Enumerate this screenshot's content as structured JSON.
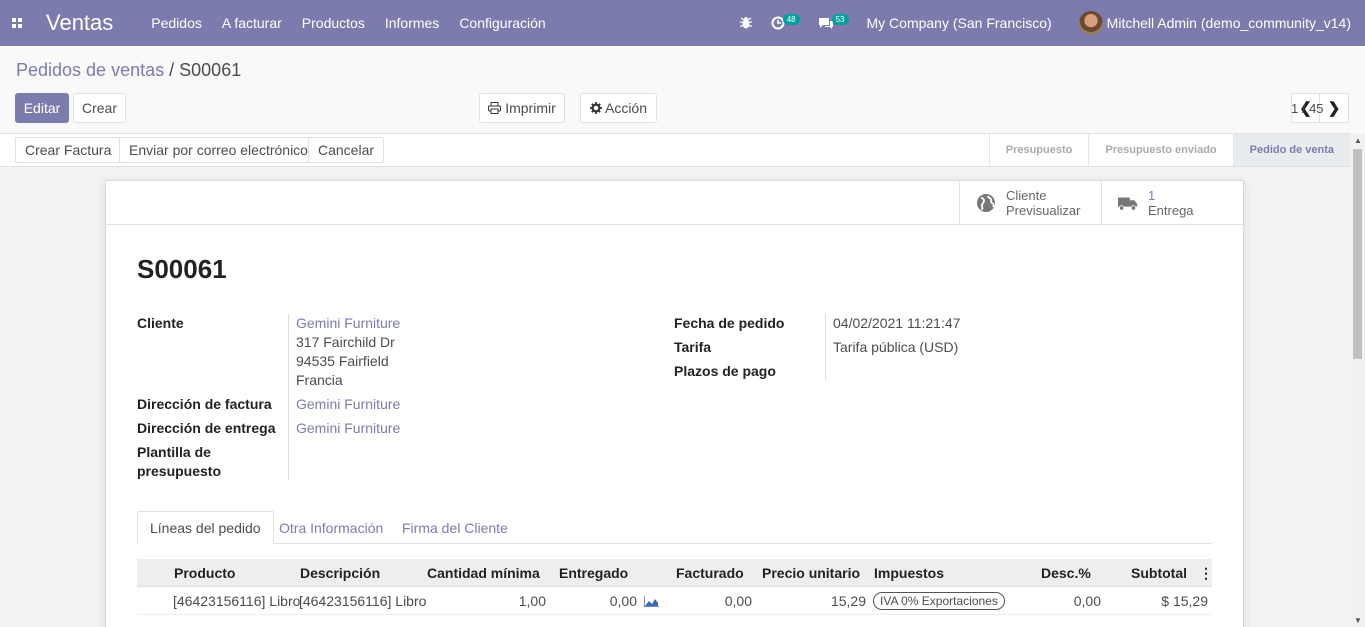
{
  "navbar": {
    "app_name": "Ventas",
    "menu": [
      "Pedidos",
      "A facturar",
      "Productos",
      "Informes",
      "Configuración"
    ],
    "activity_count": "48",
    "messages_count": "53",
    "company": "My Company (San Francisco)",
    "user": "Mitchell Admin (demo_community_v14)"
  },
  "breadcrumb": {
    "parent": "Pedidos de ventas",
    "separator": "/",
    "current": "S00061"
  },
  "actions": {
    "edit": "Editar",
    "create": "Crear",
    "print": "Imprimir",
    "action": "Acción"
  },
  "pager": {
    "value": "1 / 45"
  },
  "statusbar": {
    "buttons": [
      "Crear Factura",
      "Enviar por correo electrónico",
      "Cancelar"
    ],
    "stages": [
      "Presupuesto",
      "Presupuesto enviado",
      "Pedido de venta"
    ],
    "active_stage": "Pedido de venta"
  },
  "smart_buttons": {
    "preview_line1": "Cliente",
    "preview_line2": "Previsualizar",
    "delivery_count": "1",
    "delivery_label": "Entrega"
  },
  "order": {
    "name": "S00061",
    "labels": {
      "customer": "Cliente",
      "invoice_address": "Dirección de factura",
      "delivery_address": "Dirección de entrega",
      "template_line1": "Plantilla de",
      "template_line2": "presupuesto",
      "order_date": "Fecha de pedido",
      "pricelist": "Tarifa",
      "payment_terms": "Plazos de pago"
    },
    "customer_name": "Gemini Furniture",
    "customer_street": "317 Fairchild Dr",
    "customer_city": "94535 Fairfield",
    "customer_country": "Francia",
    "invoice_address": "Gemini Furniture",
    "delivery_address": "Gemini Furniture",
    "order_date": "04/02/2021 11:21:47",
    "pricelist": "Tarifa pública (USD)"
  },
  "tabs": [
    "Líneas del pedido",
    "Otra Información",
    "Firma del Cliente"
  ],
  "lines": {
    "headers": [
      "Producto",
      "Descripción",
      "Cantidad mínima",
      "Entregado",
      "Facturado",
      "Precio unitario",
      "Impuestos",
      "Desc.%",
      "Subtotal"
    ],
    "rows": [
      {
        "product": "[46423156116] Libro",
        "description": "[46423156116] Libro",
        "qty": "1,00",
        "delivered": "0,00",
        "invoiced": "0,00",
        "price": "15,29",
        "tax": "IVA 0% Exportaciones",
        "discount": "0,00",
        "subtotal": "$ 15,29"
      }
    ]
  },
  "colors": {
    "brand": "#7c7bad",
    "tag": "#00a09d"
  }
}
